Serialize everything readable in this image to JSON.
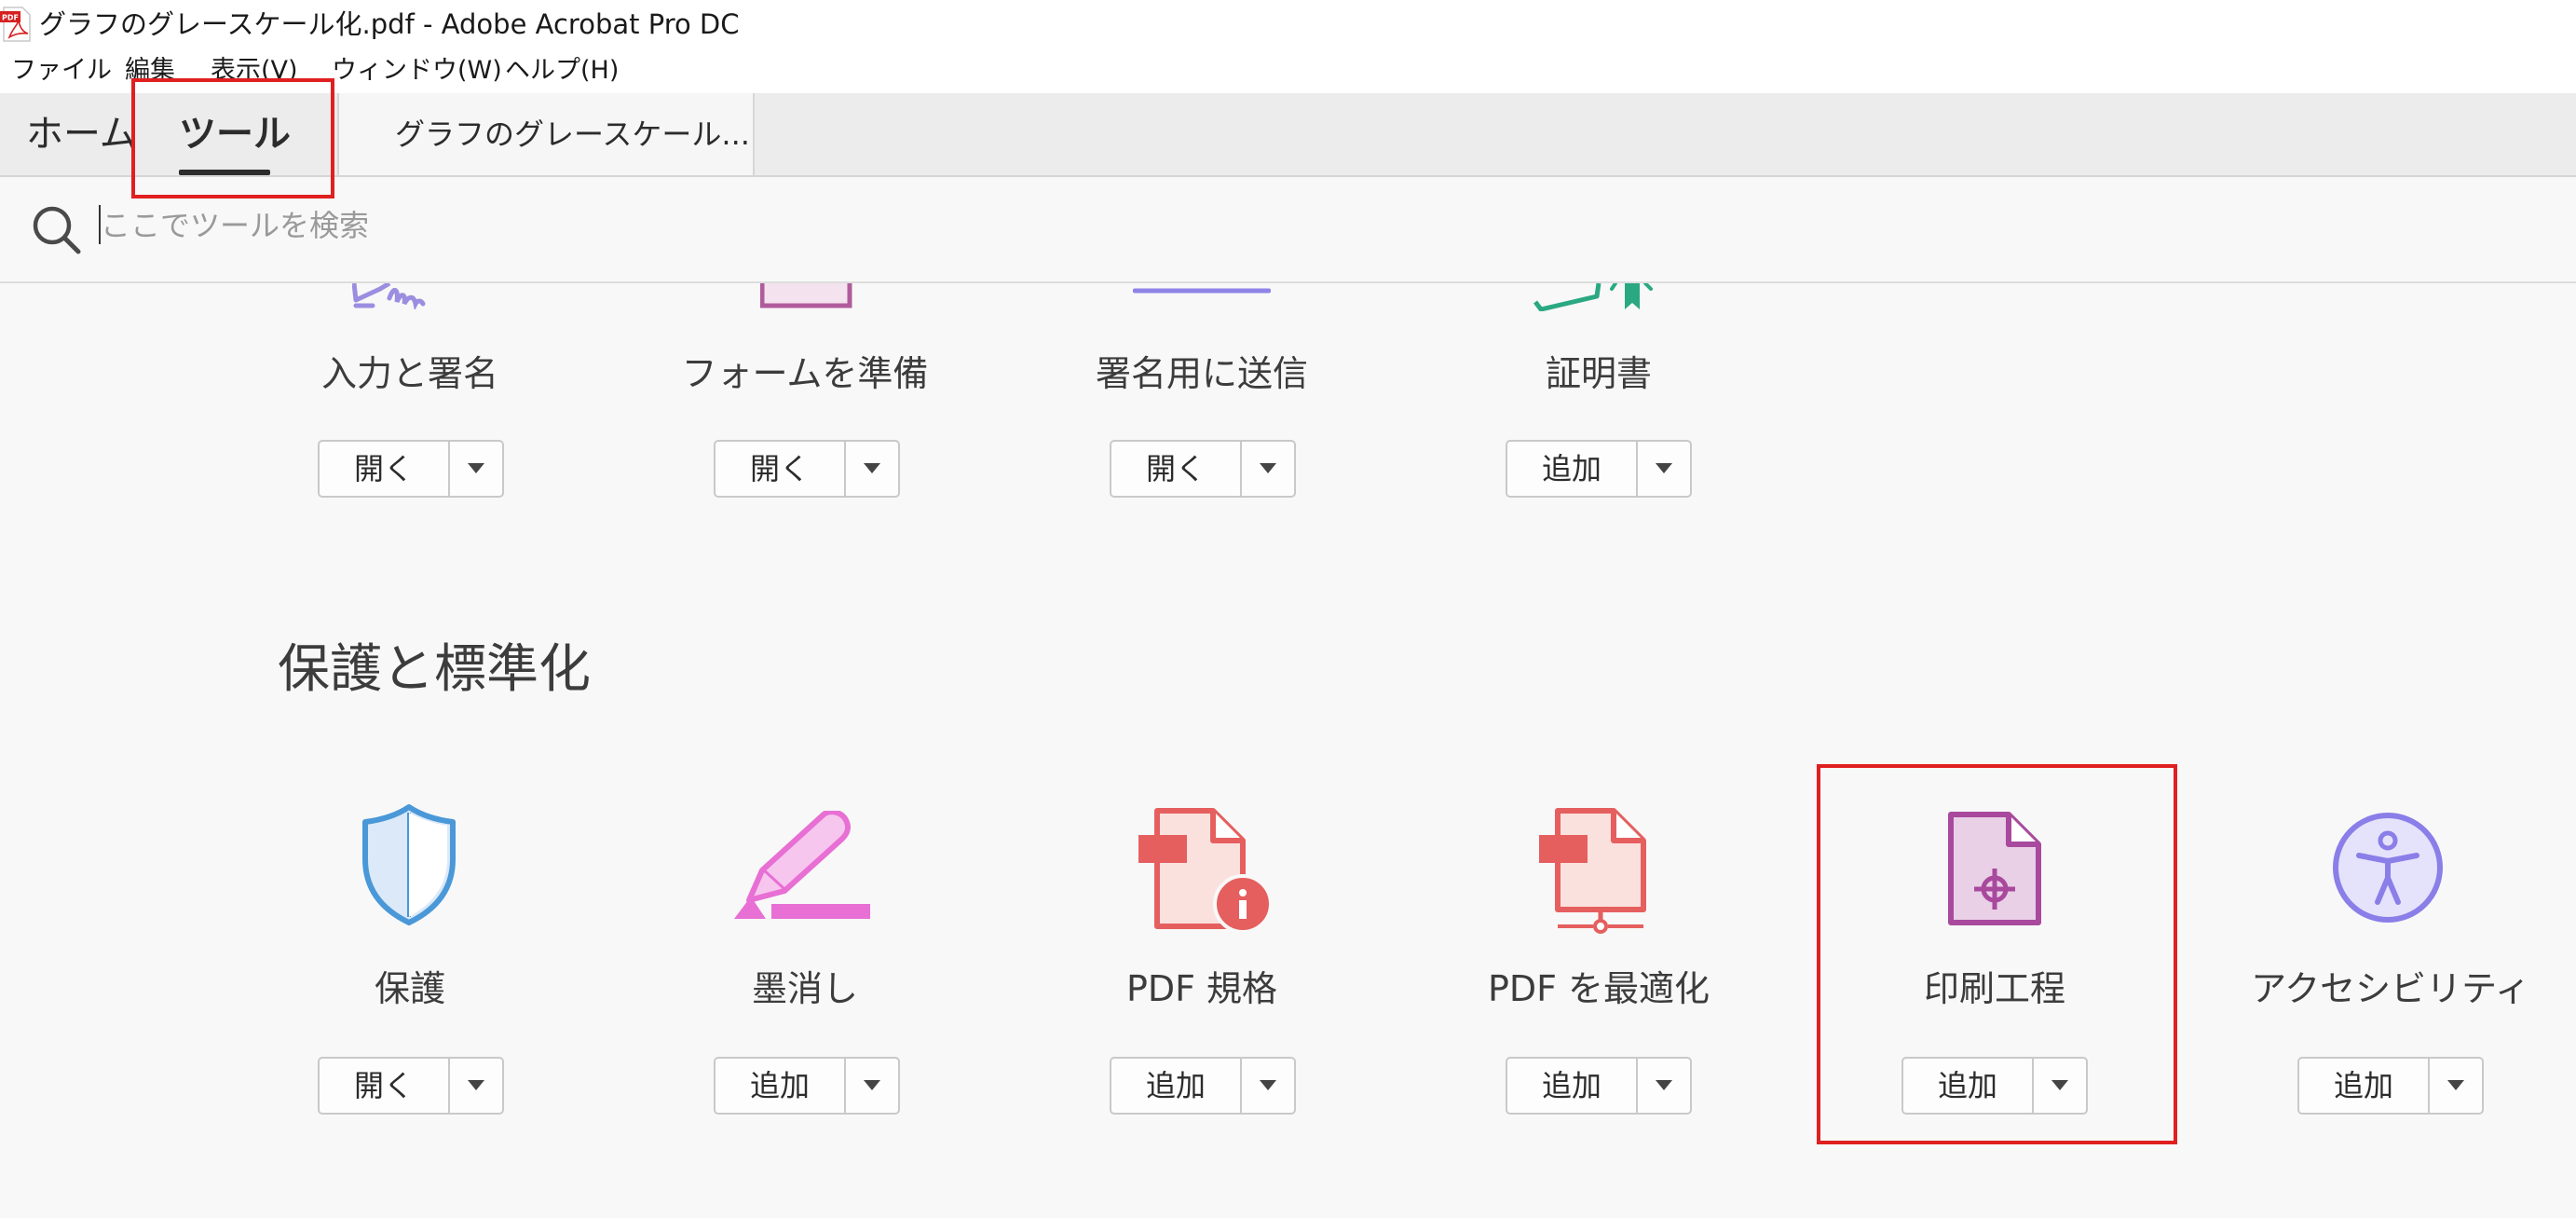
{
  "window": {
    "title": "グラフのグレースケール化.pdf - Adobe Acrobat Pro DC",
    "app_icon": "acrobat-pdf-icon",
    "app_icon_text": "PDF"
  },
  "menu": [
    "ファイル",
    "編集",
    "表示(V)",
    "ウィンドウ(W)",
    "ヘルプ(H)"
  ],
  "tabs": {
    "home": "ホーム",
    "tools": "ツール",
    "document": "グラフのグレースケール..."
  },
  "search": {
    "icon": "search-icon",
    "placeholder": "ここでツールを検索"
  },
  "top_tools": [
    {
      "label": "入力と署名",
      "button": "開く",
      "icon": "fill-sign-icon",
      "color": "#9b8ee0"
    },
    {
      "label": "フォームを準備",
      "button": "開く",
      "icon": "prepare-form-icon",
      "color": "#b05c9c"
    },
    {
      "label": "署名用に送信",
      "button": "開く",
      "icon": "send-for-signature-icon",
      "color": "#8e84e6"
    },
    {
      "label": "証明書",
      "button": "追加",
      "icon": "certificates-icon",
      "color": "#2aa882"
    }
  ],
  "section": {
    "title": "保護と標準化",
    "tools": [
      {
        "label": "保護",
        "button": "開く",
        "icon": "shield-icon",
        "color": "#4a98d8"
      },
      {
        "label": "墨消し",
        "button": "追加",
        "icon": "redact-icon",
        "color": "#e86fd4"
      },
      {
        "label": "PDF 規格",
        "button": "追加",
        "icon": "pdf-standards-icon",
        "color": "#e55f5f"
      },
      {
        "label": "PDF を最適化",
        "button": "追加",
        "icon": "optimize-pdf-icon",
        "color": "#e55f5f"
      },
      {
        "label": "印刷工程",
        "button": "追加",
        "icon": "print-production-icon",
        "color": "#a8499e"
      },
      {
        "label": "アクセシビリティ",
        "button": "追加",
        "icon": "accessibility-icon",
        "color": "#8a7ee8"
      }
    ]
  },
  "highlight_color": "#e02020"
}
